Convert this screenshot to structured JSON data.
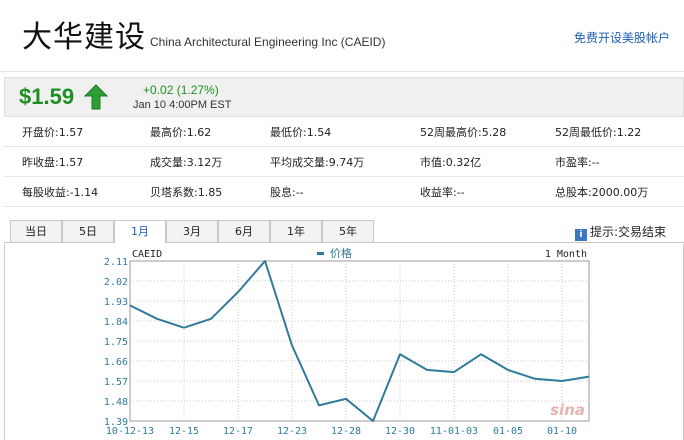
{
  "header": {
    "cn_name": "大华建设",
    "en_name": "China Architectural Engineering Inc (CAEID)",
    "open_account_link": "免费开设美股帐户"
  },
  "quote": {
    "price": "$1.59",
    "change": "+0.02 (1.27%)",
    "timestamp": "Jan 10 4:00PM EST",
    "direction_icon": "up-arrow-icon",
    "up_color": "#1d8f23"
  },
  "stats": [
    [
      "开盘价:1.57",
      "最高价:1.62",
      "最低价:1.54",
      "52周最高价:5.28",
      "52周最低价:1.22"
    ],
    [
      "昨收盘:1.57",
      "成交量:3.12万",
      "平均成交量:9.74万",
      "市值:0.32亿",
      "市盈率:--"
    ],
    [
      "每股收益:-1.14",
      "贝塔系数:1.85",
      "股息:--",
      "收益率:--",
      "总股本:2000.00万"
    ]
  ],
  "tabs": [
    {
      "label": "当日",
      "active": false
    },
    {
      "label": "5日",
      "active": false
    },
    {
      "label": "1月",
      "active": true
    },
    {
      "label": "3月",
      "active": false
    },
    {
      "label": "6月",
      "active": false
    },
    {
      "label": "1年",
      "active": false
    },
    {
      "label": "5年",
      "active": false
    }
  ],
  "tip": "提示:交易结束",
  "chart_data": {
    "type": "line",
    "symbol": "CAEID",
    "legend": "价格",
    "period_label": "1 Month",
    "watermark": "sina",
    "line_color": "#2f7b9c",
    "ylim": [
      1.39,
      2.11
    ],
    "yticks": [
      "2.11",
      "2.02",
      "1.93",
      "1.84",
      "1.75",
      "1.66",
      "1.57",
      "1.48",
      "1.39"
    ],
    "xticks": [
      {
        "label": "10-12-13",
        "index": 0
      },
      {
        "label": "12-15",
        "index": 2
      },
      {
        "label": "12-17",
        "index": 4
      },
      {
        "label": "12-23",
        "index": 6
      },
      {
        "label": "12-28",
        "index": 8
      },
      {
        "label": "12-30",
        "index": 10
      },
      {
        "label": "11-01-03",
        "index": 12
      },
      {
        "label": "01-05",
        "index": 14
      },
      {
        "label": "01-10",
        "index": 16
      }
    ],
    "values": [
      1.91,
      1.85,
      1.81,
      1.85,
      1.97,
      2.11,
      1.73,
      1.46,
      1.49,
      1.39,
      1.69,
      1.62,
      1.61,
      1.69,
      1.62,
      1.58,
      1.57,
      1.59
    ]
  }
}
